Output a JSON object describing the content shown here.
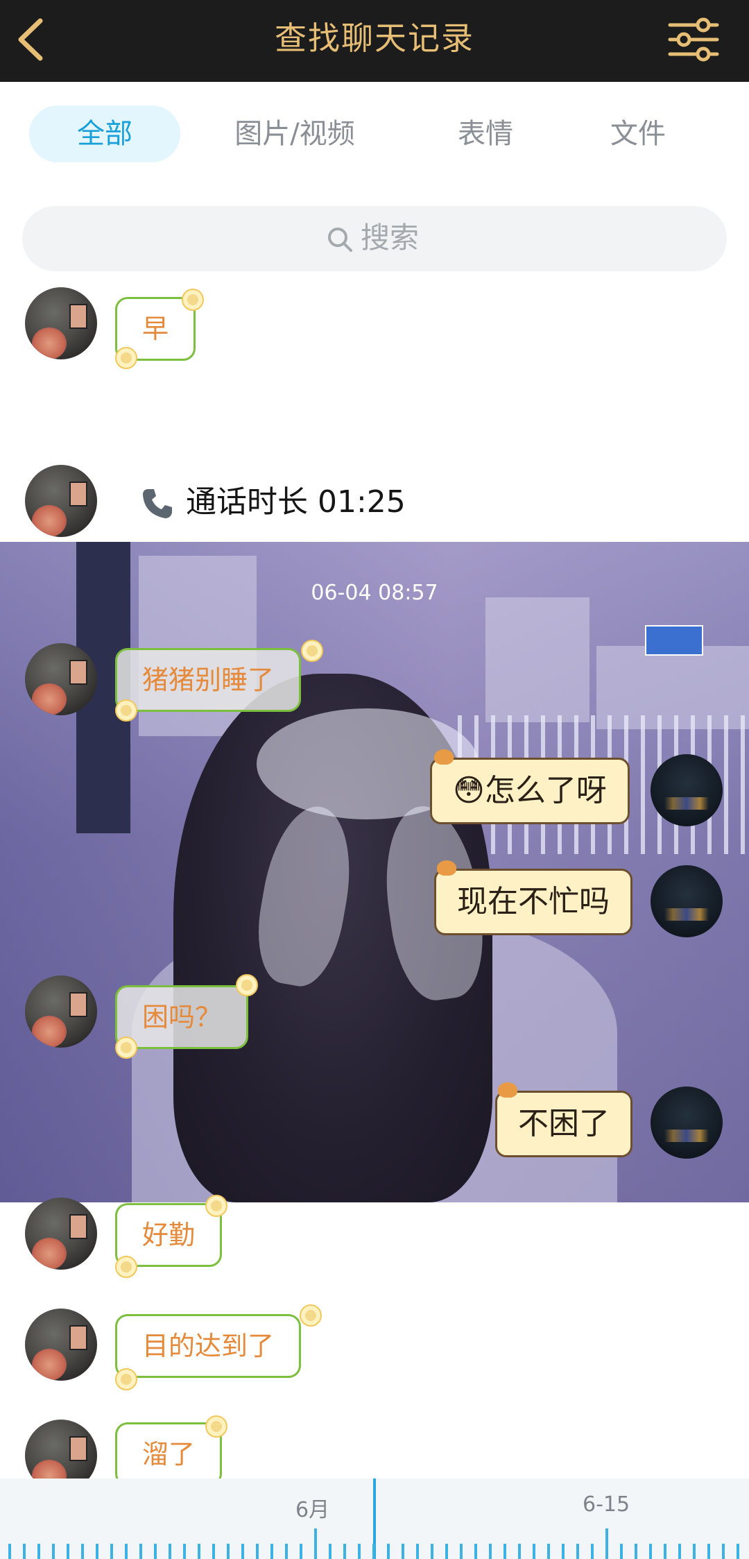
{
  "header": {
    "title": "查找聊天记录",
    "back_icon": "chevron-left-icon",
    "filter_icon": "sliders-icon"
  },
  "tabs": [
    {
      "label": "全部",
      "active": true
    },
    {
      "label": "图片/视频",
      "active": false
    },
    {
      "label": "表情",
      "active": false
    },
    {
      "label": "文件",
      "active": false
    }
  ],
  "search": {
    "placeholder": "搜索"
  },
  "messages": {
    "m1": {
      "text": "早"
    },
    "call": {
      "text": "通话时长 01:25"
    },
    "timestamp": "06-04 08:57",
    "m2": {
      "text": "猪猪别睡了"
    },
    "m3": {
      "text": "怎么了呀",
      "emoji": "😳"
    },
    "m4": {
      "text": "现在不忙吗"
    },
    "m5": {
      "text": "困吗？"
    },
    "m6": {
      "text": "不困了"
    },
    "m7": {
      "text": "好勤"
    },
    "m8": {
      "text": "目的达到了"
    },
    "m9": {
      "text": "溜了"
    }
  },
  "timeline": {
    "label_month": "6月",
    "label_date": "6-15"
  },
  "colors": {
    "header_bg": "#1c1c1c",
    "header_text": "#e7be76",
    "tab_active": "#1aa0d8",
    "friend_text": "#e58a3b",
    "bubble_border": "#7bbf3c",
    "timeline_tick": "#3bb2e3"
  }
}
